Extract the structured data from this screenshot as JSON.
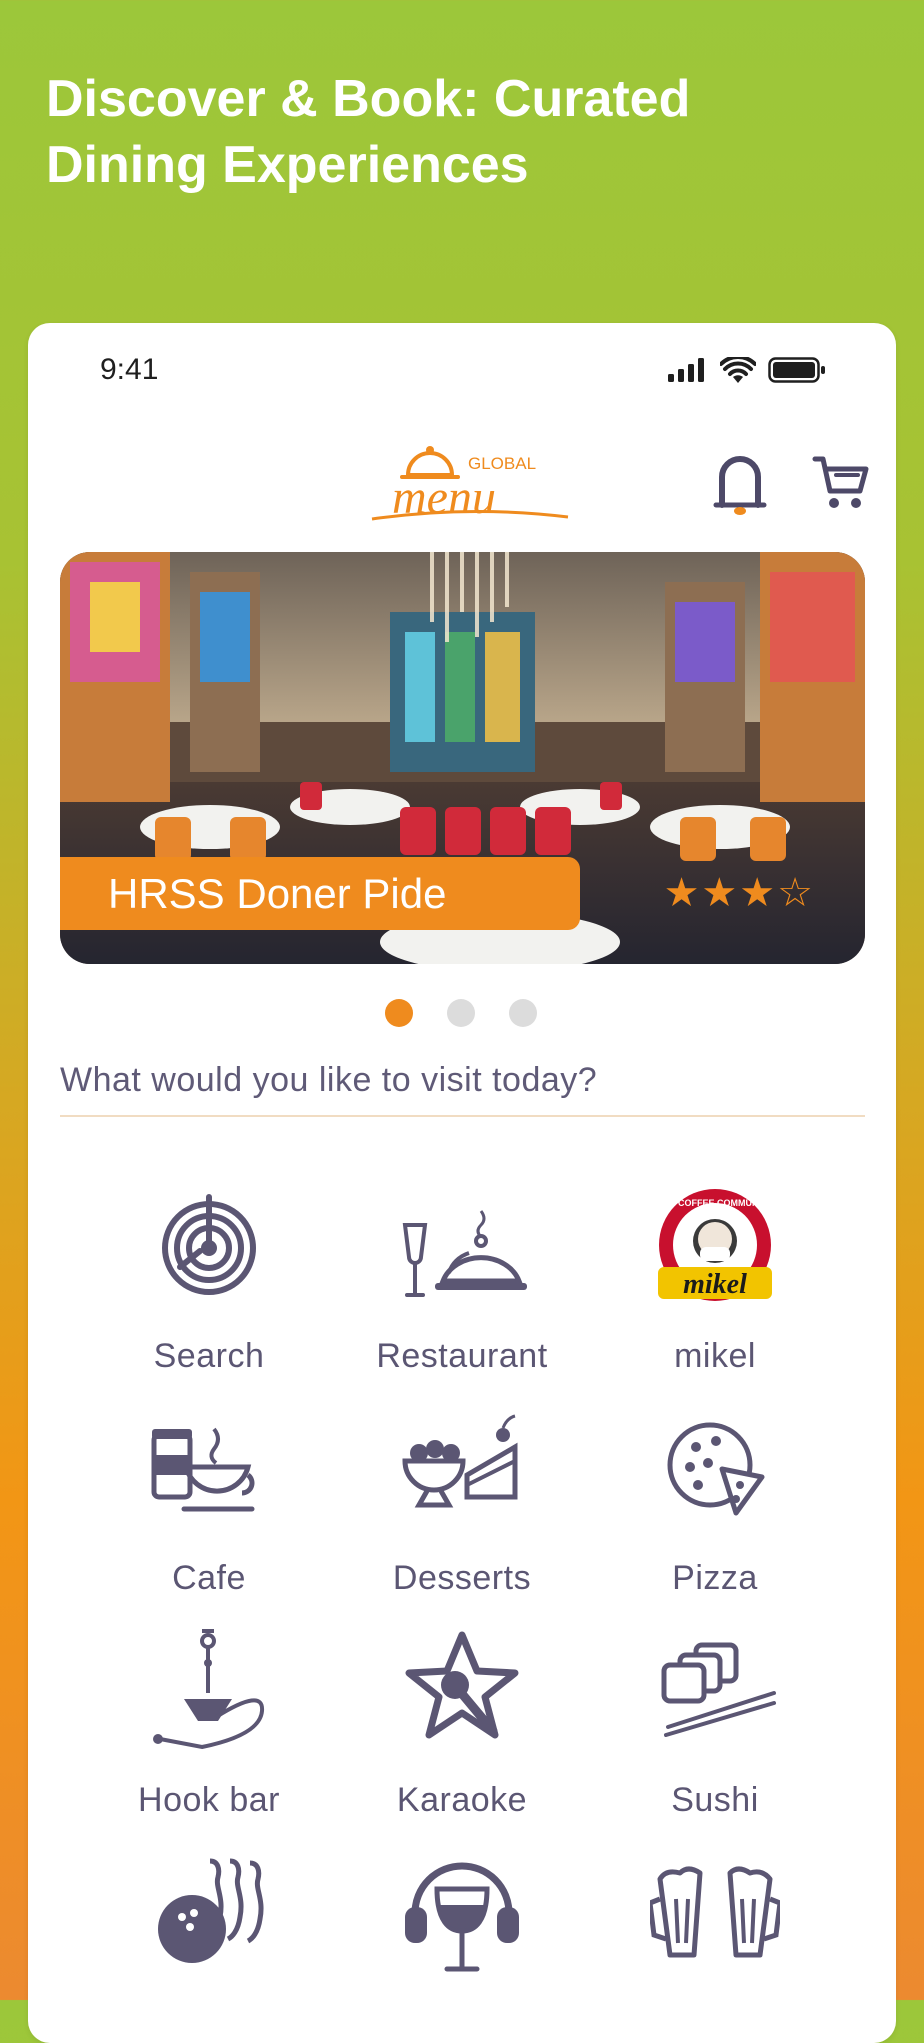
{
  "headline": "Discover & Book: Curated Dining Experiences",
  "status_bar": {
    "time": "9:41"
  },
  "header": {
    "logo_small": "GLOBAL",
    "logo_main": "menu"
  },
  "carousel": {
    "title": "HRSS Doner Pide",
    "rating": 3,
    "rating_max": 4,
    "stars_text": "★★★☆",
    "active_index": 0,
    "slide_count": 3
  },
  "prompt": "What would you like to visit today?",
  "categories": [
    {
      "label": "Search",
      "icon": "radar-icon"
    },
    {
      "label": "Restaurant",
      "icon": "cloche-icon"
    },
    {
      "label": "mikel",
      "icon": "mikel-logo-icon",
      "logo_text": "THE COFFEE COMMUNITY"
    },
    {
      "label": "Cafe",
      "icon": "coffee-cup-icon"
    },
    {
      "label": "Desserts",
      "icon": "dessert-icon"
    },
    {
      "label": "Pizza",
      "icon": "pizza-icon"
    },
    {
      "label": "Hook bar",
      "icon": "hookah-icon"
    },
    {
      "label": "Karaoke",
      "icon": "microphone-star-icon"
    },
    {
      "label": "Sushi",
      "icon": "sushi-icon"
    },
    {
      "label": "",
      "icon": "bowling-icon"
    },
    {
      "label": "",
      "icon": "headphones-wine-icon"
    },
    {
      "label": "",
      "icon": "beer-mugs-icon"
    }
  ],
  "colors": {
    "accent": "#ef8b1e",
    "icon": "#5b5673"
  }
}
